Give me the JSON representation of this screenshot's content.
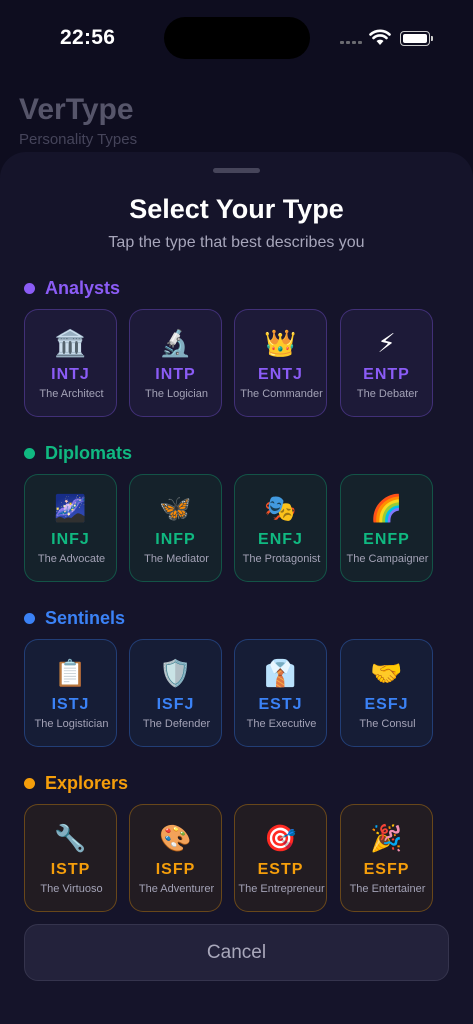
{
  "status_bar": {
    "time": "22:56"
  },
  "background": {
    "app_title": "VerType",
    "app_subtitle": "Personality Types"
  },
  "sheet": {
    "title": "Select Your Type",
    "subtitle": "Tap the type that best describes you",
    "cancel_label": "Cancel"
  },
  "groups": [
    {
      "name": "Analysts",
      "color": "#8b5cf6",
      "types": [
        {
          "emoji": "🏛️",
          "code": "INTJ",
          "desc": "The Architect"
        },
        {
          "emoji": "🔬",
          "code": "INTP",
          "desc": "The Logician"
        },
        {
          "emoji": "👑",
          "code": "ENTJ",
          "desc": "The Commander"
        },
        {
          "emoji": "⚡",
          "code": "ENTP",
          "desc": "The Debater"
        }
      ]
    },
    {
      "name": "Diplomats",
      "color": "#10b981",
      "types": [
        {
          "emoji": "🌌",
          "code": "INFJ",
          "desc": "The Advocate"
        },
        {
          "emoji": "🦋",
          "code": "INFP",
          "desc": "The Mediator"
        },
        {
          "emoji": "🎭",
          "code": "ENFJ",
          "desc": "The Protagonist"
        },
        {
          "emoji": "🌈",
          "code": "ENFP",
          "desc": "The Campaigner"
        }
      ]
    },
    {
      "name": "Sentinels",
      "color": "#3b82f6",
      "types": [
        {
          "emoji": "📋",
          "code": "ISTJ",
          "desc": "The Logistician"
        },
        {
          "emoji": "🛡️",
          "code": "ISFJ",
          "desc": "The Defender"
        },
        {
          "emoji": "👔",
          "code": "ESTJ",
          "desc": "The Executive"
        },
        {
          "emoji": "🤝",
          "code": "ESFJ",
          "desc": "The Consul"
        }
      ]
    },
    {
      "name": "Explorers",
      "color": "#f59e0b",
      "types": [
        {
          "emoji": "🔧",
          "code": "ISTP",
          "desc": "The Virtuoso"
        },
        {
          "emoji": "🎨",
          "code": "ISFP",
          "desc": "The Adventurer"
        },
        {
          "emoji": "🎯",
          "code": "ESTP",
          "desc": "The Entrepreneur"
        },
        {
          "emoji": "🎉",
          "code": "ESFP",
          "desc": "The Entertainer"
        }
      ]
    }
  ]
}
